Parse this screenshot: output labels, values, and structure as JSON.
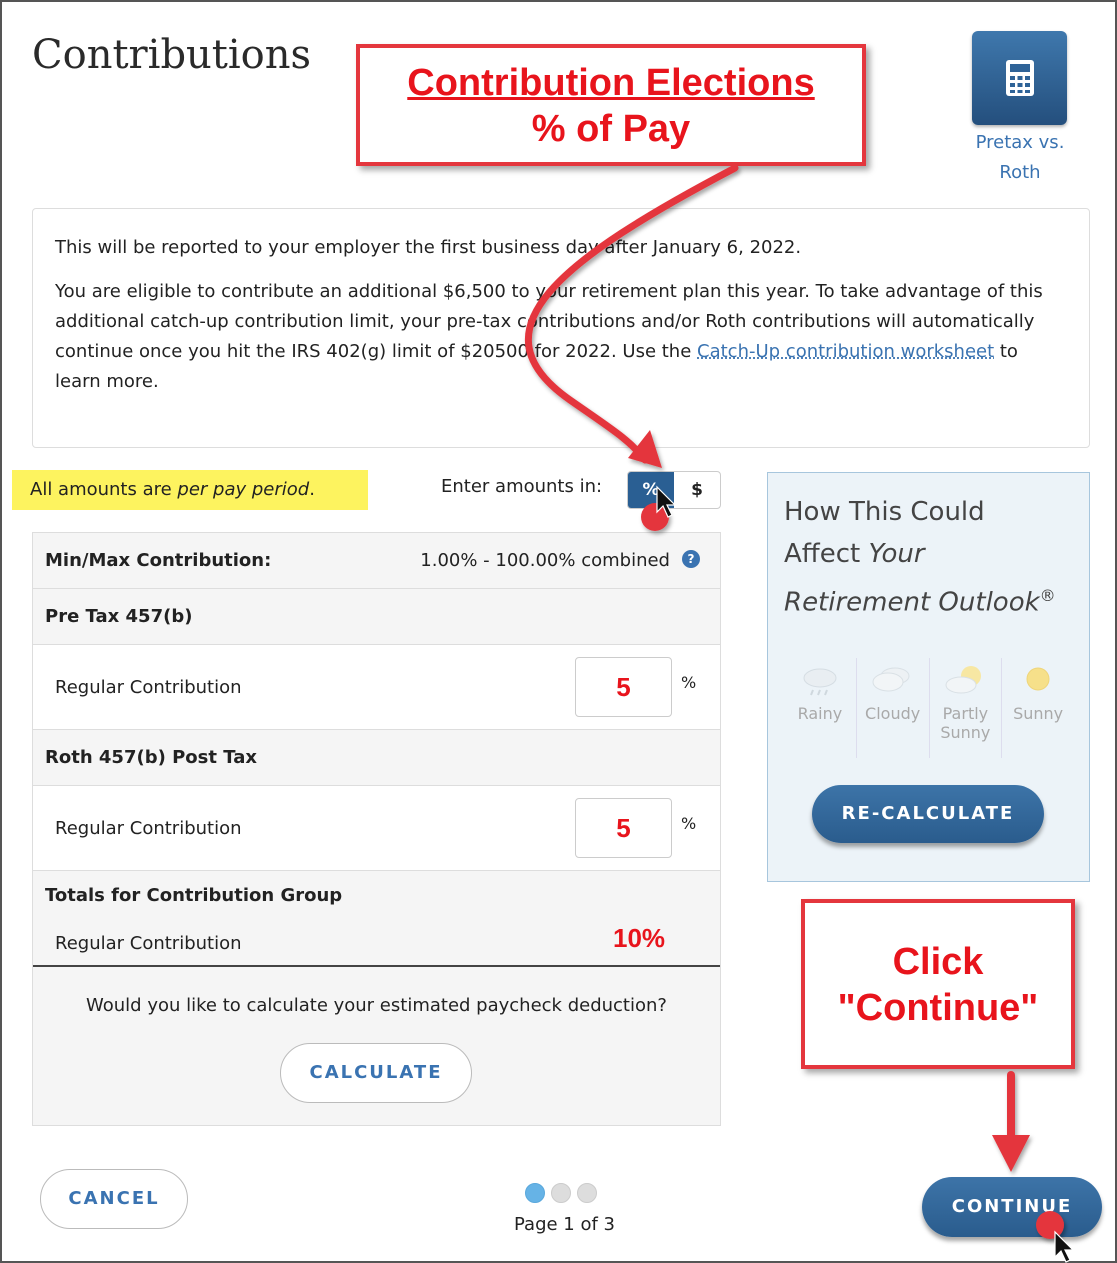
{
  "page": {
    "title": "Contributions"
  },
  "roth_button": {
    "label": "Pretax vs. Roth",
    "icon": "calculator-icon"
  },
  "info": {
    "line1": "This will be reported to your employer the first business day after January 6, 2022.",
    "line2_pre": "You are eligible to contribute an additional $6,500 to your retirement plan this year. To take advantage of this additional catch-up contribution limit, your pre-tax contributions and/or Roth contributions will automatically continue once you hit the IRS 402(g) limit of $20500 for 2022. Use the ",
    "link": "Catch-Up contribution worksheet",
    "line2_post": " to learn more."
  },
  "note": {
    "prefix": "All amounts are ",
    "emph": "per pay period",
    "suffix": "."
  },
  "amount_toggle": {
    "label": "Enter amounts in:",
    "percent": "%",
    "dollar": "$",
    "selected": "%"
  },
  "table": {
    "minmax_label": "Min/Max Contribution:",
    "minmax_value": "1.00% - 100.00% combined",
    "help_icon": "?",
    "pretax_header": "Pre Tax 457(b)",
    "pretax_row_label": "Regular Contribution",
    "pretax_value": "5",
    "roth_header": "Roth 457(b) Post Tax",
    "roth_row_label": "Regular Contribution",
    "roth_value": "5",
    "unit": "%",
    "totals_header": "Totals for Contribution Group",
    "totals_row_label": "Regular Contribution",
    "totals_value": "10%",
    "calc_question": "Would you like to calculate your estimated paycheck deduction?",
    "calc_button": "CALCULATE"
  },
  "outlook": {
    "title_line1": "How This Could",
    "title_line2_pre": "Affect ",
    "title_line2_emph": "Your",
    "title_line3": "Retirement Outlook",
    "title_reg": "®",
    "weather": [
      "Rainy",
      "Cloudy",
      "Partly Sunny",
      "Sunny"
    ],
    "recalc_button": "RE-CALCULATE"
  },
  "footer": {
    "cancel_button": "CANCEL",
    "page_indicator": "Page 1 of 3",
    "continue_button": "CONTINUE",
    "current_page": 1,
    "total_pages": 3
  },
  "annotations": {
    "callout1_line1": "Contribution Elections",
    "callout1_line2": "% of Pay",
    "callout2_line1": "Click",
    "callout2_line2": "\"Continue\"",
    "color": "#e4363d"
  }
}
